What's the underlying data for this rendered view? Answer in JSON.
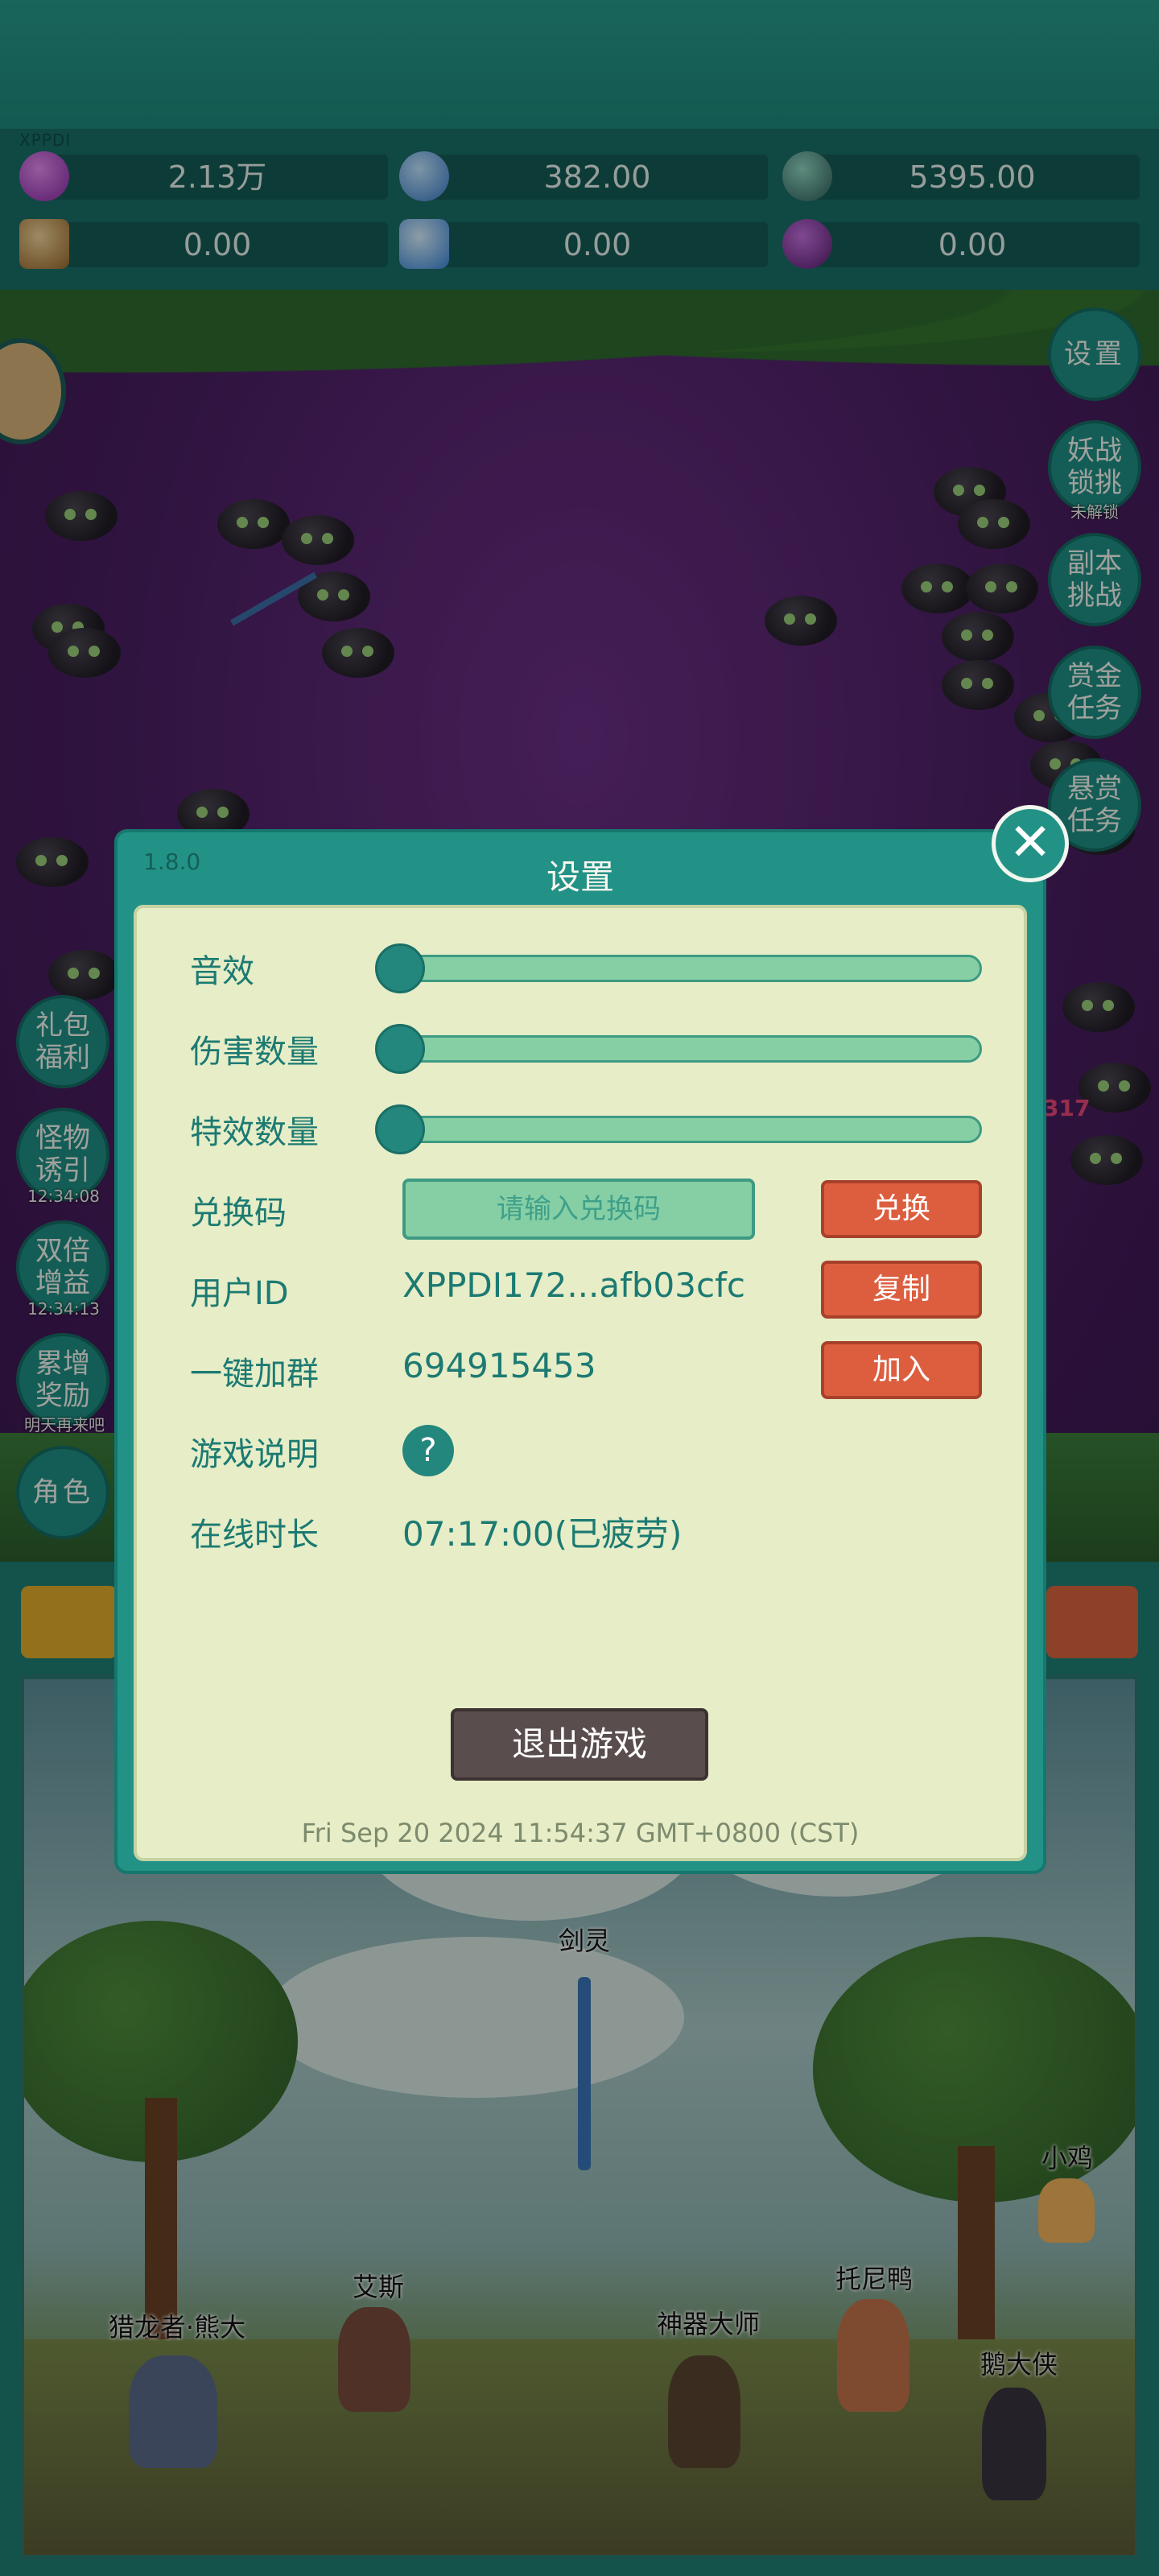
{
  "header": {
    "tiny_label": "XPPDI",
    "resources_row1": [
      {
        "icon": "gem-icon",
        "value": "2.13万"
      },
      {
        "icon": "crystal-orb-icon",
        "value": "382.00"
      },
      {
        "icon": "helmet-icon",
        "value": "5395.00"
      }
    ],
    "resources_row2": [
      {
        "icon": "scroll-icon",
        "value": "0.00"
      },
      {
        "icon": "ice-shard-icon",
        "value": "0.00"
      },
      {
        "icon": "potion-icon",
        "value": "0.00"
      }
    ]
  },
  "side_menu_right": {
    "settings": "设置",
    "monster_challenge": "妖战锁挑",
    "monster_challenge_sub": "未解锁",
    "dungeon_challenge": "副本挑战",
    "gold_quest": "赏金任务",
    "bounty_quest": "悬赏任务"
  },
  "side_menu_left": {
    "gift": "礼包福利",
    "lure": "怪物诱引",
    "lure_timer": "12:34:08",
    "double": "双倍增益",
    "double_timer": "12:34:13",
    "reward": "累增奖励",
    "reward_sub": "明天再来吧",
    "role": "角色"
  },
  "battle": {
    "damage_number": "317"
  },
  "dialog": {
    "version": "1.8.0",
    "title": "设置",
    "sound_label": "音效",
    "sound_level": 0,
    "damage_count_label": "伤害数量",
    "damage_count_level": 0,
    "effect_count_label": "特效数量",
    "effect_count_level": 0,
    "redeem_label": "兑换码",
    "redeem_placeholder": "请输入兑换码",
    "redeem_button": "兑换",
    "user_id_label": "用户ID",
    "user_id_value": "XPPDI172...afb03cfc",
    "copy_button": "复制",
    "group_label": "一键加群",
    "group_value": "694915453",
    "join_button": "加入",
    "guide_label": "游戏说明",
    "guide_button": "?",
    "online_label": "在线时长",
    "online_value": "07:17:00(已疲劳)",
    "exit_button": "退出游戏",
    "timestamp": "Fri Sep 20 2024 11:54:37 GMT+0800 (CST)"
  },
  "scene": {
    "sword_spirit": "剑灵",
    "chick": "小鸡",
    "ace": "艾斯",
    "tony_duck": "托尼鸭",
    "dragon_hunter": "猎龙者·熊大",
    "artifact_master": "神器大师",
    "goose_hero": "鹅大侠"
  },
  "colors": {
    "teal": "#239286",
    "panel_bg": "#e6edc7",
    "red_button": "#dd5e3f",
    "exit_button": "#5a4d4d"
  }
}
